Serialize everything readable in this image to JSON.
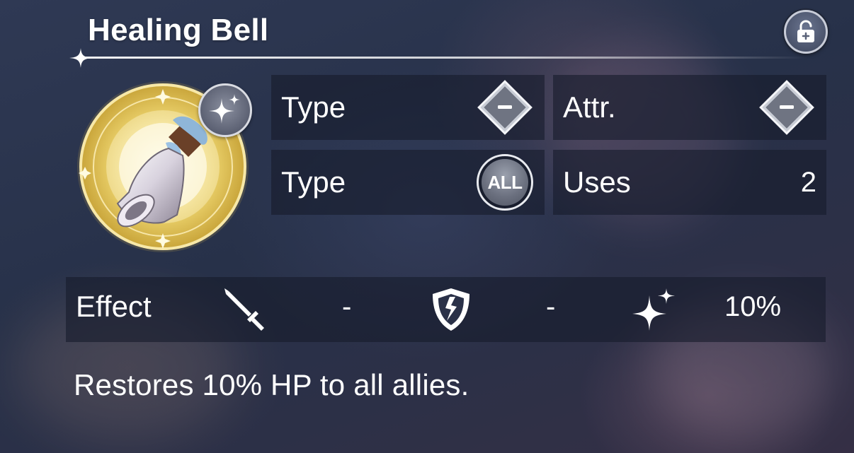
{
  "item": {
    "name": "Healing Bell",
    "description": "Restores 10% HP to all allies."
  },
  "icons": {
    "lock": "unlocked-padlock-icon",
    "item": "silver-bell-icon",
    "rarity": "sparkle-icon",
    "type_badge": "diamond-dash-icon",
    "attr_badge": "diamond-dash-icon",
    "target_badge": "all-target-icon",
    "attack": "sword-icon",
    "defense": "cracked-shield-icon",
    "heal": "sparkle-icon"
  },
  "stats": {
    "type_label": "Type",
    "attr_label": "Attr.",
    "target_label": "Type",
    "target_value": "ALL",
    "uses_label": "Uses",
    "uses_value": "2"
  },
  "effect": {
    "label": "Effect",
    "attack_value": "-",
    "defense_value": "-",
    "heal_value": "10%"
  },
  "colors": {
    "panel": "#161b2c",
    "gold_frame": "#d9b84a",
    "text": "#ffffff"
  }
}
